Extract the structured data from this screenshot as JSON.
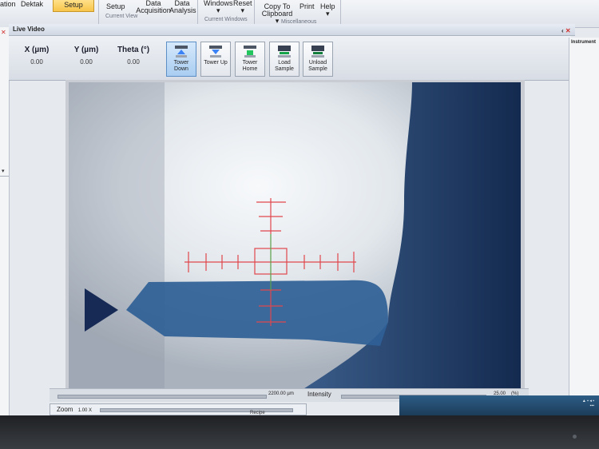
{
  "ribbon": {
    "items": [
      {
        "label": "ation",
        "name": "calibration-tab"
      },
      {
        "label": "Dektak",
        "name": "dektak-tab"
      },
      {
        "label": "Setup",
        "name": "setup-tab-active"
      },
      {
        "label": "Setup",
        "name": "setup-button"
      },
      {
        "label": "Data Acquisition",
        "name": "data-acquisition-button"
      },
      {
        "label": "Data Analysis",
        "name": "data-analysis-button"
      },
      {
        "label": "Windows",
        "name": "windows-menu"
      },
      {
        "label": "Reset",
        "name": "reset-menu"
      },
      {
        "label": "Copy To Clipboard",
        "name": "copy-to-clipboard-button"
      },
      {
        "label": "Print",
        "name": "print-button"
      },
      {
        "label": "Help",
        "name": "help-button"
      }
    ],
    "groups": {
      "current_view": "Current View",
      "current_windows": "Current Windows",
      "miscellaneous": "Miscellaneous"
    }
  },
  "live_video": {
    "title": "Live Video",
    "coords": [
      {
        "label": "X (µm)",
        "value": "0.00"
      },
      {
        "label": "Y (µm)",
        "value": "0.00"
      },
      {
        "label": "Theta (°)",
        "value": "0.00"
      }
    ],
    "buttons": [
      {
        "label": "Tower Down",
        "icon": "tower-down-icon",
        "active": true
      },
      {
        "label": "Tower Up",
        "icon": "tower-up-icon",
        "active": false
      },
      {
        "label": "Tower Home",
        "icon": "tower-home-icon",
        "active": false
      },
      {
        "label": "Load Sample",
        "icon": "load-sample-icon",
        "active": false
      },
      {
        "label": "Unload Sample",
        "icon": "unload-sample-icon",
        "active": false
      }
    ]
  },
  "instrument_panel": {
    "title": "Instrument"
  },
  "bottom": {
    "scan_length": "2200.00 µm",
    "intensity_label": "Intensity",
    "intensity_value": "25.00",
    "intensity_unit": "(%)",
    "zoom_label": "Zoom",
    "zoom_value": "1.00 X",
    "recipe_label": "Recipe"
  },
  "colors": {
    "active_tab": "#f7c54a",
    "crosshair": "#e0474c",
    "crosshair_center": "#3fb24a",
    "taskbar": "#1f4566"
  }
}
